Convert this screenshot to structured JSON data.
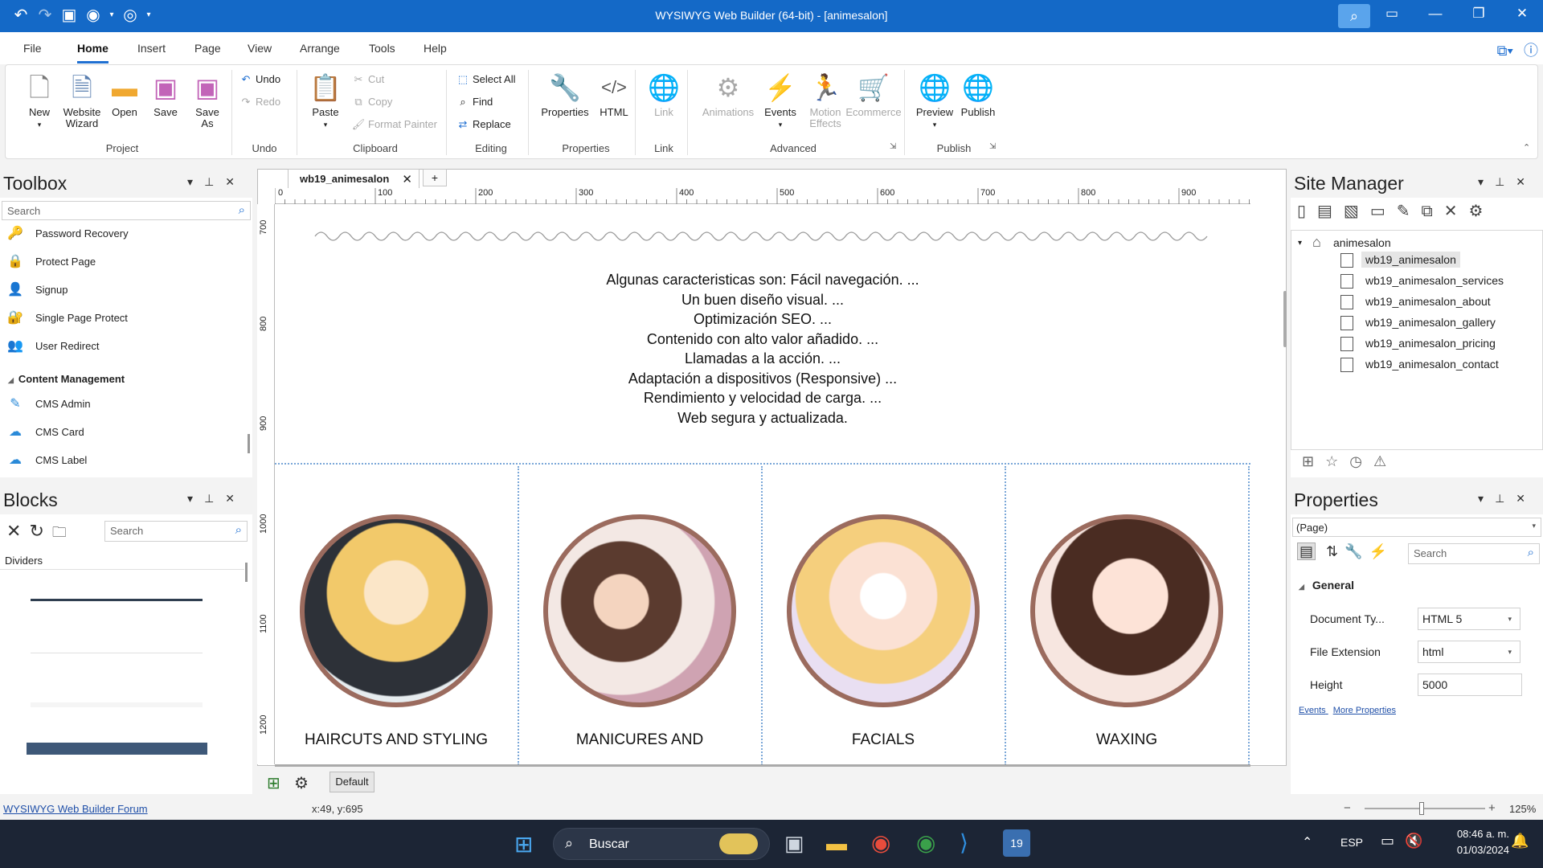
{
  "window": {
    "title": "WYSIWYG Web Builder (64-bit) - [animesalon]",
    "min_icon": "minimize-icon",
    "max_icon": "maximize-icon",
    "close_icon": "close-icon"
  },
  "menu": [
    "File",
    "Home",
    "Insert",
    "Page",
    "View",
    "Arrange",
    "Tools",
    "Help"
  ],
  "ribbon": {
    "project": {
      "label": "Project",
      "new": "New",
      "wizard_1": "Website",
      "wizard_2": "Wizard",
      "open": "Open",
      "save": "Save",
      "saveas_1": "Save",
      "saveas_2": "As"
    },
    "undo": {
      "label": "Undo",
      "undo": "Undo",
      "redo": "Redo"
    },
    "clipboard": {
      "label": "Clipboard",
      "paste": "Paste",
      "cut": "Cut",
      "copy": "Copy",
      "format_painter": "Format Painter"
    },
    "editing": {
      "label": "Editing",
      "select_all": "Select All",
      "find": "Find",
      "replace": "Replace"
    },
    "properties": {
      "label": "Properties",
      "properties": "Properties",
      "html": "HTML"
    },
    "link": {
      "label": "Link",
      "link": "Link"
    },
    "advanced": {
      "label": "Advanced",
      "animations": "Animations",
      "events": "Events",
      "motion_1": "Motion",
      "motion_2": "Effects",
      "ecommerce": "Ecommerce"
    },
    "publish": {
      "label": "Publish",
      "preview": "Preview",
      "publish": "Publish"
    }
  },
  "toolbox": {
    "title": "Toolbox",
    "search_placeholder": "Search",
    "items_a": [
      "Password Recovery",
      "Protect Page",
      "Signup",
      "Single Page Protect",
      "User Redirect"
    ],
    "category": "Content Management",
    "items_b": [
      "CMS Admin",
      "CMS Card",
      "CMS Label"
    ]
  },
  "blocks": {
    "title": "Blocks",
    "search_placeholder": "Search",
    "category": "Dividers"
  },
  "document": {
    "tab": "wb19_animesalon",
    "ruler_h": [
      "0",
      "100",
      "200",
      "300",
      "400",
      "500",
      "600",
      "700",
      "800",
      "900"
    ],
    "ruler_v": [
      "700",
      "800",
      "900",
      "1000",
      "1100",
      "1200"
    ],
    "features": [
      "Algunas caracteristicas son: Fácil navegación. ...",
      "Un buen diseño visual. ...",
      "Optimización SEO. ...",
      "Contenido con alto valor añadido. ...",
      "Llamadas a la acción. ...",
      "Adaptación a dispositivos (Responsive) ...",
      "Rendimiento y velocidad de carga. ...",
      "Web segura y actualizada."
    ],
    "services": [
      "HAIRCUTS AND STYLING",
      "MANICURES AND",
      "FACIALS",
      "WAXING"
    ],
    "default_button": "Default"
  },
  "site_manager": {
    "title": "Site Manager",
    "root": "animesalon",
    "pages": [
      "wb19_animesalon",
      "wb19_animesalon_services",
      "wb19_animesalon_about",
      "wb19_animesalon_gallery",
      "wb19_animesalon_pricing",
      "wb19_animesalon_contact"
    ],
    "selected": "wb19_animesalon"
  },
  "properties": {
    "title": "Properties",
    "object": "(Page)",
    "search_placeholder": "Search",
    "section": "General",
    "rows": [
      {
        "label": "Document Ty...",
        "value": "HTML 5"
      },
      {
        "label": "File Extension",
        "value": "html"
      },
      {
        "label": "Height",
        "value": "5000"
      }
    ],
    "links": {
      "events": "Events",
      "more": "More Properties"
    }
  },
  "status": {
    "forum_link": "WYSIWYG Web Builder Forum",
    "coords": "x:49, y:695",
    "zoom": "125%"
  },
  "taskbar": {
    "search": "Buscar",
    "lang": "ESP",
    "time": "08:46 a. m.",
    "date": "01/03/2024"
  },
  "colors": {
    "titlebar": "#1469c7",
    "accent": "#1f6fd1",
    "circle_border": "#9b6b5e",
    "taskbar": "#1c2535"
  }
}
